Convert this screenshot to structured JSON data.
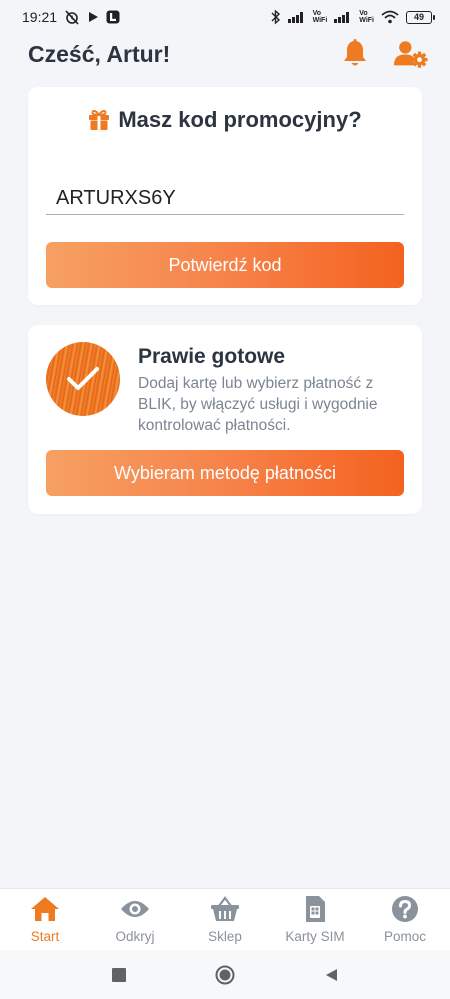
{
  "status_bar": {
    "time": "19:21",
    "battery": "49",
    "vowifi_top": "Vo",
    "vowifi_bottom": "WiFi"
  },
  "header": {
    "greeting": "Cześć, Artur!",
    "notification_icon": "bell-icon",
    "settings_icon": "user-gear-icon"
  },
  "promo": {
    "title": "Masz kod promocyjny?",
    "icon": "gift-icon",
    "code_value": "ARTURXS6Y",
    "confirm_label": "Potwierdź kod"
  },
  "ready": {
    "title": "Prawie gotowe",
    "description": "Dodaj kartę lub wybierz płatność z BLIK, by włączyć usługi i wygodnie kontrolować płatności.",
    "button_label": "Wybieram metodę płatności"
  },
  "bottom_nav": {
    "items": [
      {
        "label": "Start",
        "icon": "home-icon",
        "active": true
      },
      {
        "label": "Odkryj",
        "icon": "eye-icon",
        "active": false
      },
      {
        "label": "Sklep",
        "icon": "basket-icon",
        "active": false
      },
      {
        "label": "Karty SIM",
        "icon": "sim-card-icon",
        "active": false
      },
      {
        "label": "Pomoc",
        "icon": "help-icon",
        "active": false
      }
    ]
  },
  "colors": {
    "accent": "#ee7b22",
    "button_start": "#f7a063",
    "button_end": "#f4621f",
    "background": "#f3f5f8",
    "text_dark": "#2b3440",
    "text_muted": "#7b8591"
  }
}
